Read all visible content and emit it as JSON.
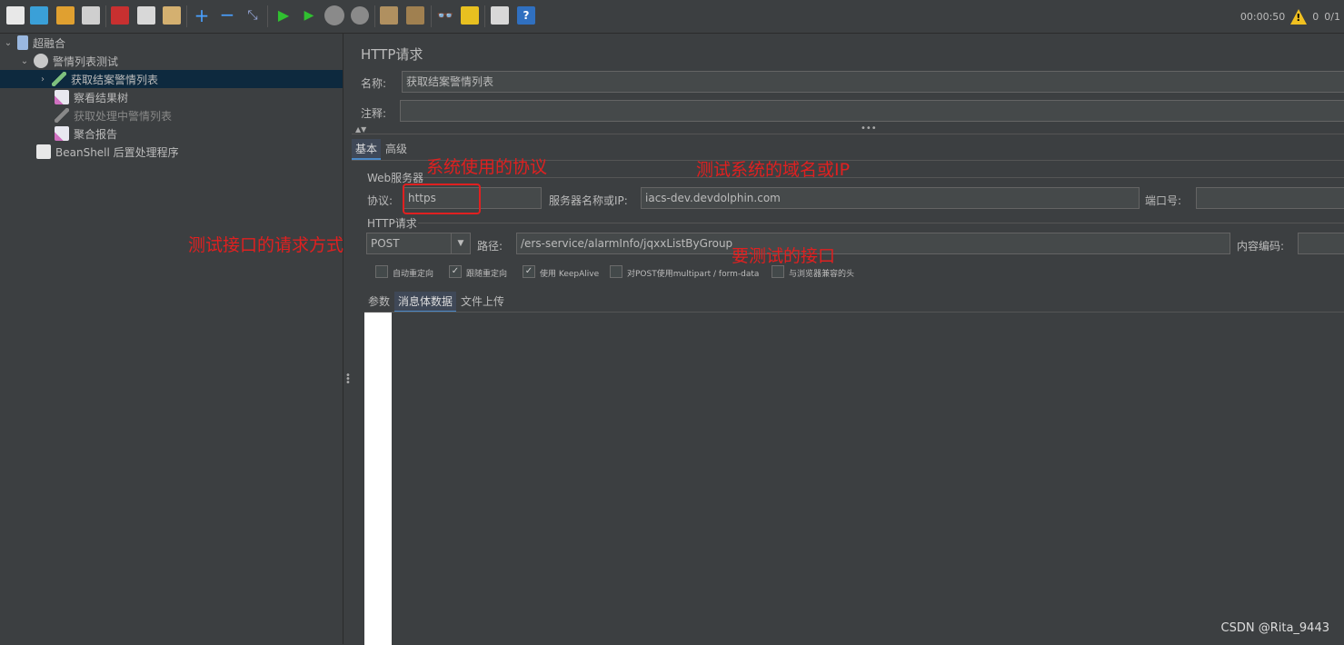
{
  "toolbar": {
    "icons": [
      "new-icon",
      "templates-icon",
      "open-icon",
      "save-icon",
      "cut-icon",
      "copy-icon",
      "paste-icon",
      "expand-icon",
      "collapse-icon",
      "toggle-icon",
      "start-icon",
      "start-no-pause-icon",
      "stop-icon",
      "shutdown-icon",
      "clear-icon",
      "clear-all-icon",
      "search-icon",
      "reset-search-icon",
      "function-helper-icon",
      "help-icon"
    ],
    "timer": "00:00:50",
    "warning_count": "0",
    "threads": "0/1"
  },
  "tree": {
    "items": [
      {
        "label": "超融合",
        "icon": "test-plan-icon"
      },
      {
        "label": "警情列表测试",
        "icon": "thread-group-icon"
      },
      {
        "label": "获取结案警情列表",
        "icon": "sampler-icon"
      },
      {
        "label": "察看结果树",
        "icon": "listener-icon"
      },
      {
        "label": "获取处理中警情列表",
        "icon": "sampler-icon"
      },
      {
        "label": "聚合报告",
        "icon": "listener-icon"
      },
      {
        "label": "BeanShell 后置处理程序",
        "icon": "postprocessor-icon"
      }
    ]
  },
  "panel": {
    "title": "HTTP请求",
    "name_label": "名称:",
    "name_value": "获取结案警情列表",
    "comment_label": "注释:",
    "comment_value": "",
    "tabs": [
      "基本",
      "高级"
    ],
    "web_server_group": "Web服务器",
    "protocol_label": "协议:",
    "protocol_value": "https",
    "server_label": "服务器名称或IP:",
    "server_value": "iacs-dev.devdolphin.com",
    "port_label": "端口号:",
    "port_value": "",
    "http_group": "HTTP请求",
    "method_value": "POST",
    "path_label": "路径:",
    "path_value": "/ers-service/alarmInfo/jqxxListByGroup",
    "encoding_label": "内容编码:",
    "checkboxes": [
      {
        "label": "自动重定向",
        "checked": false
      },
      {
        "label": "跟随重定向",
        "checked": true
      },
      {
        "label": "使用 KeepAlive",
        "checked": true
      },
      {
        "label": "对POST使用multipart / form-data",
        "checked": false
      },
      {
        "label": "与浏览器兼容的头",
        "checked": false
      }
    ],
    "body_tabs": [
      "参数",
      "消息体数据",
      "文件上传"
    ]
  },
  "annotations": {
    "protocol": "系统使用的协议",
    "domain": "测试系统的域名或IP",
    "method": "测试接口的请求方式",
    "interface": "要测试的接口"
  },
  "watermark": "CSDN @Rita_9443",
  "colors": {
    "background": "#3c3f41",
    "selected_row": "#0d293e",
    "annotation": "#e02020",
    "warning": "#f0c020"
  }
}
